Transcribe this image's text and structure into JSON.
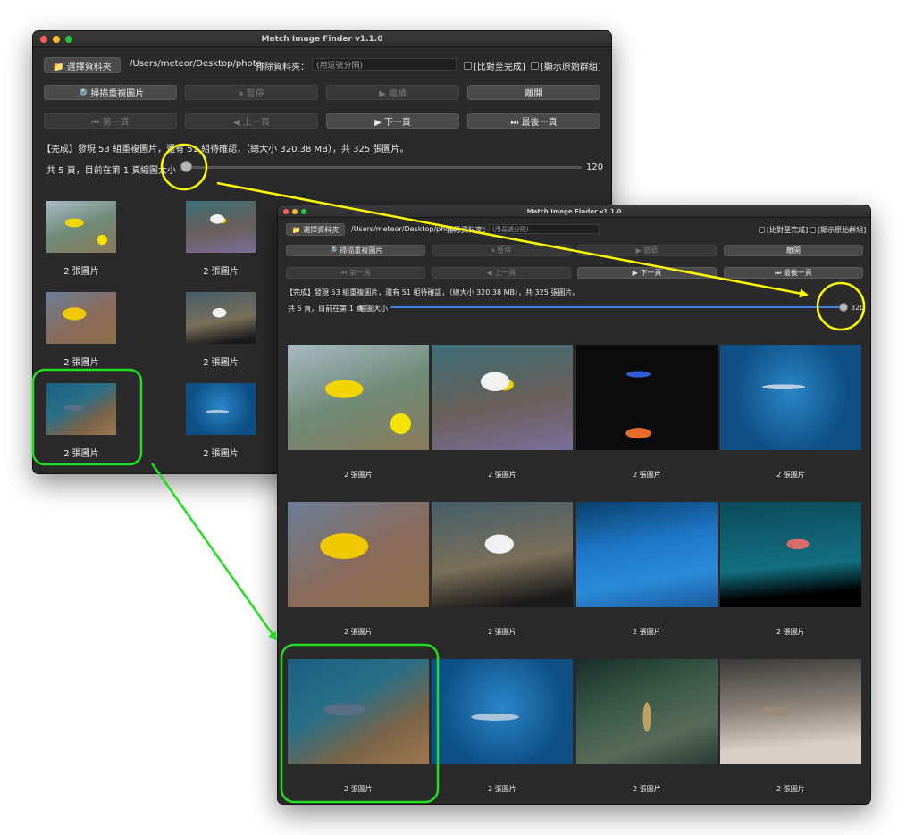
{
  "back": {
    "title": "Match Image Finder v1.1.0",
    "select_folder": "📁 選擇資料夾",
    "path": "/Users/meteor/Desktop/photo",
    "exclude_label": "排除資料夾：",
    "exclude_placeholder": "(用逗號分隔)",
    "compare_to_done": "[比對至完成]",
    "show_original_group": "[顯示原始群組]",
    "scan": "🔎 掃描重複圖片",
    "pause": "⏸ 暫停",
    "resume": "▶ 繼續",
    "leave": "離開",
    "first_page": "⏮ 第一頁",
    "prev_page": "◀ 上一頁",
    "next_page": "▶ 下一頁",
    "last_page": "⏭ 最後一頁",
    "status": "【完成】發現 53 組重複圖片，還有 51 組待確認，（總大小 320.38 MB），共 325 張圖片。",
    "page_info": "共 5 頁，目前在第 1 頁",
    "zoom_label": "縮圖大小",
    "zoom_value": "120",
    "zoom_fraction": 0.08,
    "cells": [
      {
        "caption": "2 張圖片",
        "img": "yellowfish"
      },
      {
        "caption": "2 張圖片",
        "img": "butterfly"
      },
      {
        "caption": "2 張圖片",
        "img": "rabbitfish"
      },
      {
        "caption": "2 張圖片",
        "img": "butterfly2"
      },
      {
        "caption": "2 張圖片",
        "img": "surgeon"
      },
      {
        "caption": "2 張圖片",
        "img": "hammer"
      }
    ]
  },
  "front": {
    "title": "Match Image Finder v1.1.0",
    "select_folder": "📁 選擇資料夾",
    "path": "/Users/meteor/Desktop/photo",
    "exclude_label": "排除資料夾：",
    "exclude_placeholder": "(用逗號分隔)",
    "compare_to_done": "[比對至完成]",
    "show_original_group": "[顯示原始群組]",
    "scan": "🔎 掃描重複圖片",
    "pause": "⏸ 暫停",
    "resume": "▶ 繼續",
    "leave": "離開",
    "first_page": "⏮ 第一頁",
    "prev_page": "◀ 上一頁",
    "next_page": "▶ 下一頁",
    "last_page": "⏭ 最後一頁",
    "status": "【完成】發現 53 組重複圖片，還有 51 組待確認，（總大小 320.38 MB），共 325 張圖片。",
    "page_info": "共 5 頁，目前在第 1 頁",
    "zoom_label": "縮圖大小",
    "zoom_value": "320",
    "zoom_fraction": 1.0,
    "cells": [
      {
        "caption": "2 張圖片",
        "img": "yellowfish"
      },
      {
        "caption": "2 張圖片",
        "img": "butterfly"
      },
      {
        "caption": "2 張圖片",
        "img": "dark"
      },
      {
        "caption": "2 張圖片",
        "img": "shark-blue"
      },
      {
        "caption": "2 張圖片",
        "img": "rabbitfish"
      },
      {
        "caption": "2 張圖片",
        "img": "butterfly2"
      },
      {
        "caption": "2 張圖片",
        "img": "leopardshark"
      },
      {
        "caption": "2 張圖片",
        "img": "grouper"
      },
      {
        "caption": "2 張圖片",
        "img": "surgeon"
      },
      {
        "caption": "2 張圖片",
        "img": "hammer"
      },
      {
        "caption": "2 張圖片",
        "img": "moray"
      },
      {
        "caption": "2 張圖片",
        "img": "sandfish"
      }
    ]
  },
  "annotations": {
    "zoom_highlight_color": "#ffff00",
    "selection_highlight_color": "#22dd22"
  }
}
